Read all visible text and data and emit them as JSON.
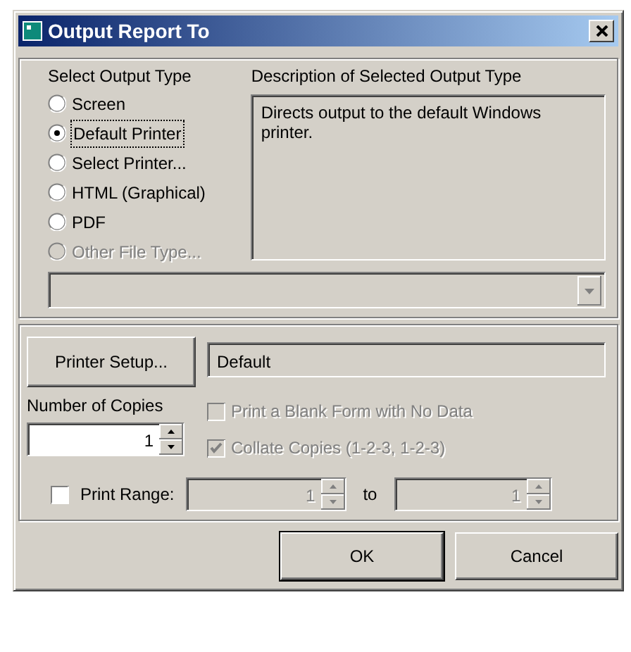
{
  "window": {
    "title": "Output Report To"
  },
  "output_type": {
    "label": "Select Output Type",
    "options": [
      {
        "label": "Screen",
        "selected": false,
        "disabled": false
      },
      {
        "label": "Default Printer",
        "selected": true,
        "disabled": false
      },
      {
        "label": "Select Printer...",
        "selected": false,
        "disabled": false
      },
      {
        "label": "HTML (Graphical)",
        "selected": false,
        "disabled": false
      },
      {
        "label": "PDF",
        "selected": false,
        "disabled": false
      },
      {
        "label": "Other File Type...",
        "selected": false,
        "disabled": true
      }
    ]
  },
  "description": {
    "label": "Description of Selected Output Type",
    "text": "Directs output to the default Windows printer."
  },
  "file_type_dropdown": {
    "disabled": true
  },
  "printer_setup_button": "Printer Setup...",
  "printer_field": {
    "value": "Default"
  },
  "copies": {
    "label": "Number of Copies",
    "value": "1"
  },
  "options": [
    {
      "label": "Print a Blank Form with No Data",
      "checked": false,
      "disabled": true
    },
    {
      "label": "Collate Copies (1-2-3, 1-2-3)",
      "checked": true,
      "disabled": true
    }
  ],
  "print_range": {
    "label": "Print Range:",
    "checked": false,
    "from": "1",
    "to_label": "to",
    "to": "1",
    "disabled": true
  },
  "buttons": [
    {
      "label": "OK",
      "default": true
    },
    {
      "label": "Cancel",
      "default": false
    }
  ]
}
